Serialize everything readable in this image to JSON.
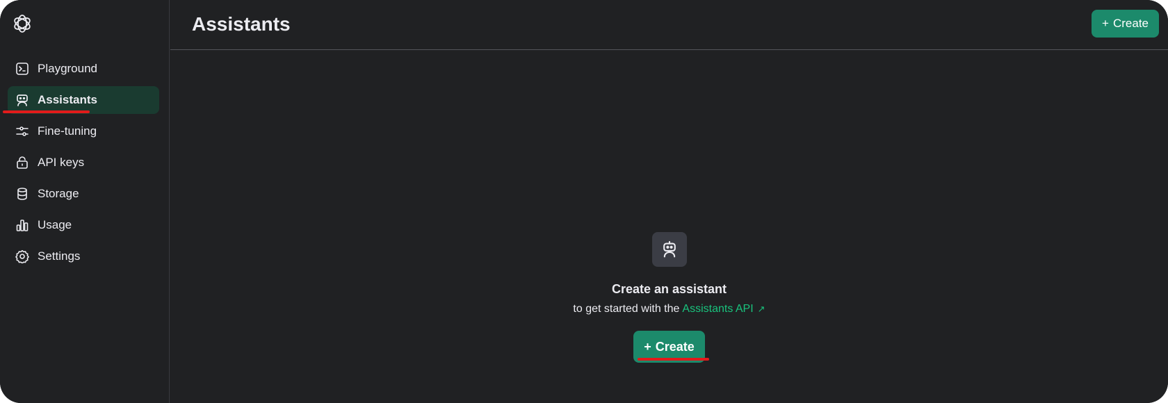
{
  "app": {
    "logo_icon": "openai-logo-icon"
  },
  "sidebar": {
    "items": [
      {
        "label": "Playground",
        "icon": "terminal-icon",
        "active": false
      },
      {
        "label": "Assistants",
        "icon": "robot-icon",
        "active": true
      },
      {
        "label": "Fine-tuning",
        "icon": "sliders-icon",
        "active": false
      },
      {
        "label": "API keys",
        "icon": "lock-icon",
        "active": false
      },
      {
        "label": "Storage",
        "icon": "database-icon",
        "active": false
      },
      {
        "label": "Usage",
        "icon": "bar-chart-icon",
        "active": false
      },
      {
        "label": "Settings",
        "icon": "gear-icon",
        "active": false
      }
    ]
  },
  "header": {
    "title": "Assistants",
    "create_button": {
      "icon": "+",
      "label": "Create"
    }
  },
  "empty_state": {
    "icon": "robot-icon",
    "title": "Create an assistant",
    "subtitle_prefix": "to get started with the",
    "link_text": "Assistants API",
    "link_icon": "↗",
    "create_button": {
      "icon": "+",
      "label": "Create"
    }
  },
  "colors": {
    "background": "#202123",
    "accent": "#1c8a6b",
    "link": "#19c37d",
    "active_nav": "#1a3b30",
    "annotation_underline": "#e11b1b"
  }
}
